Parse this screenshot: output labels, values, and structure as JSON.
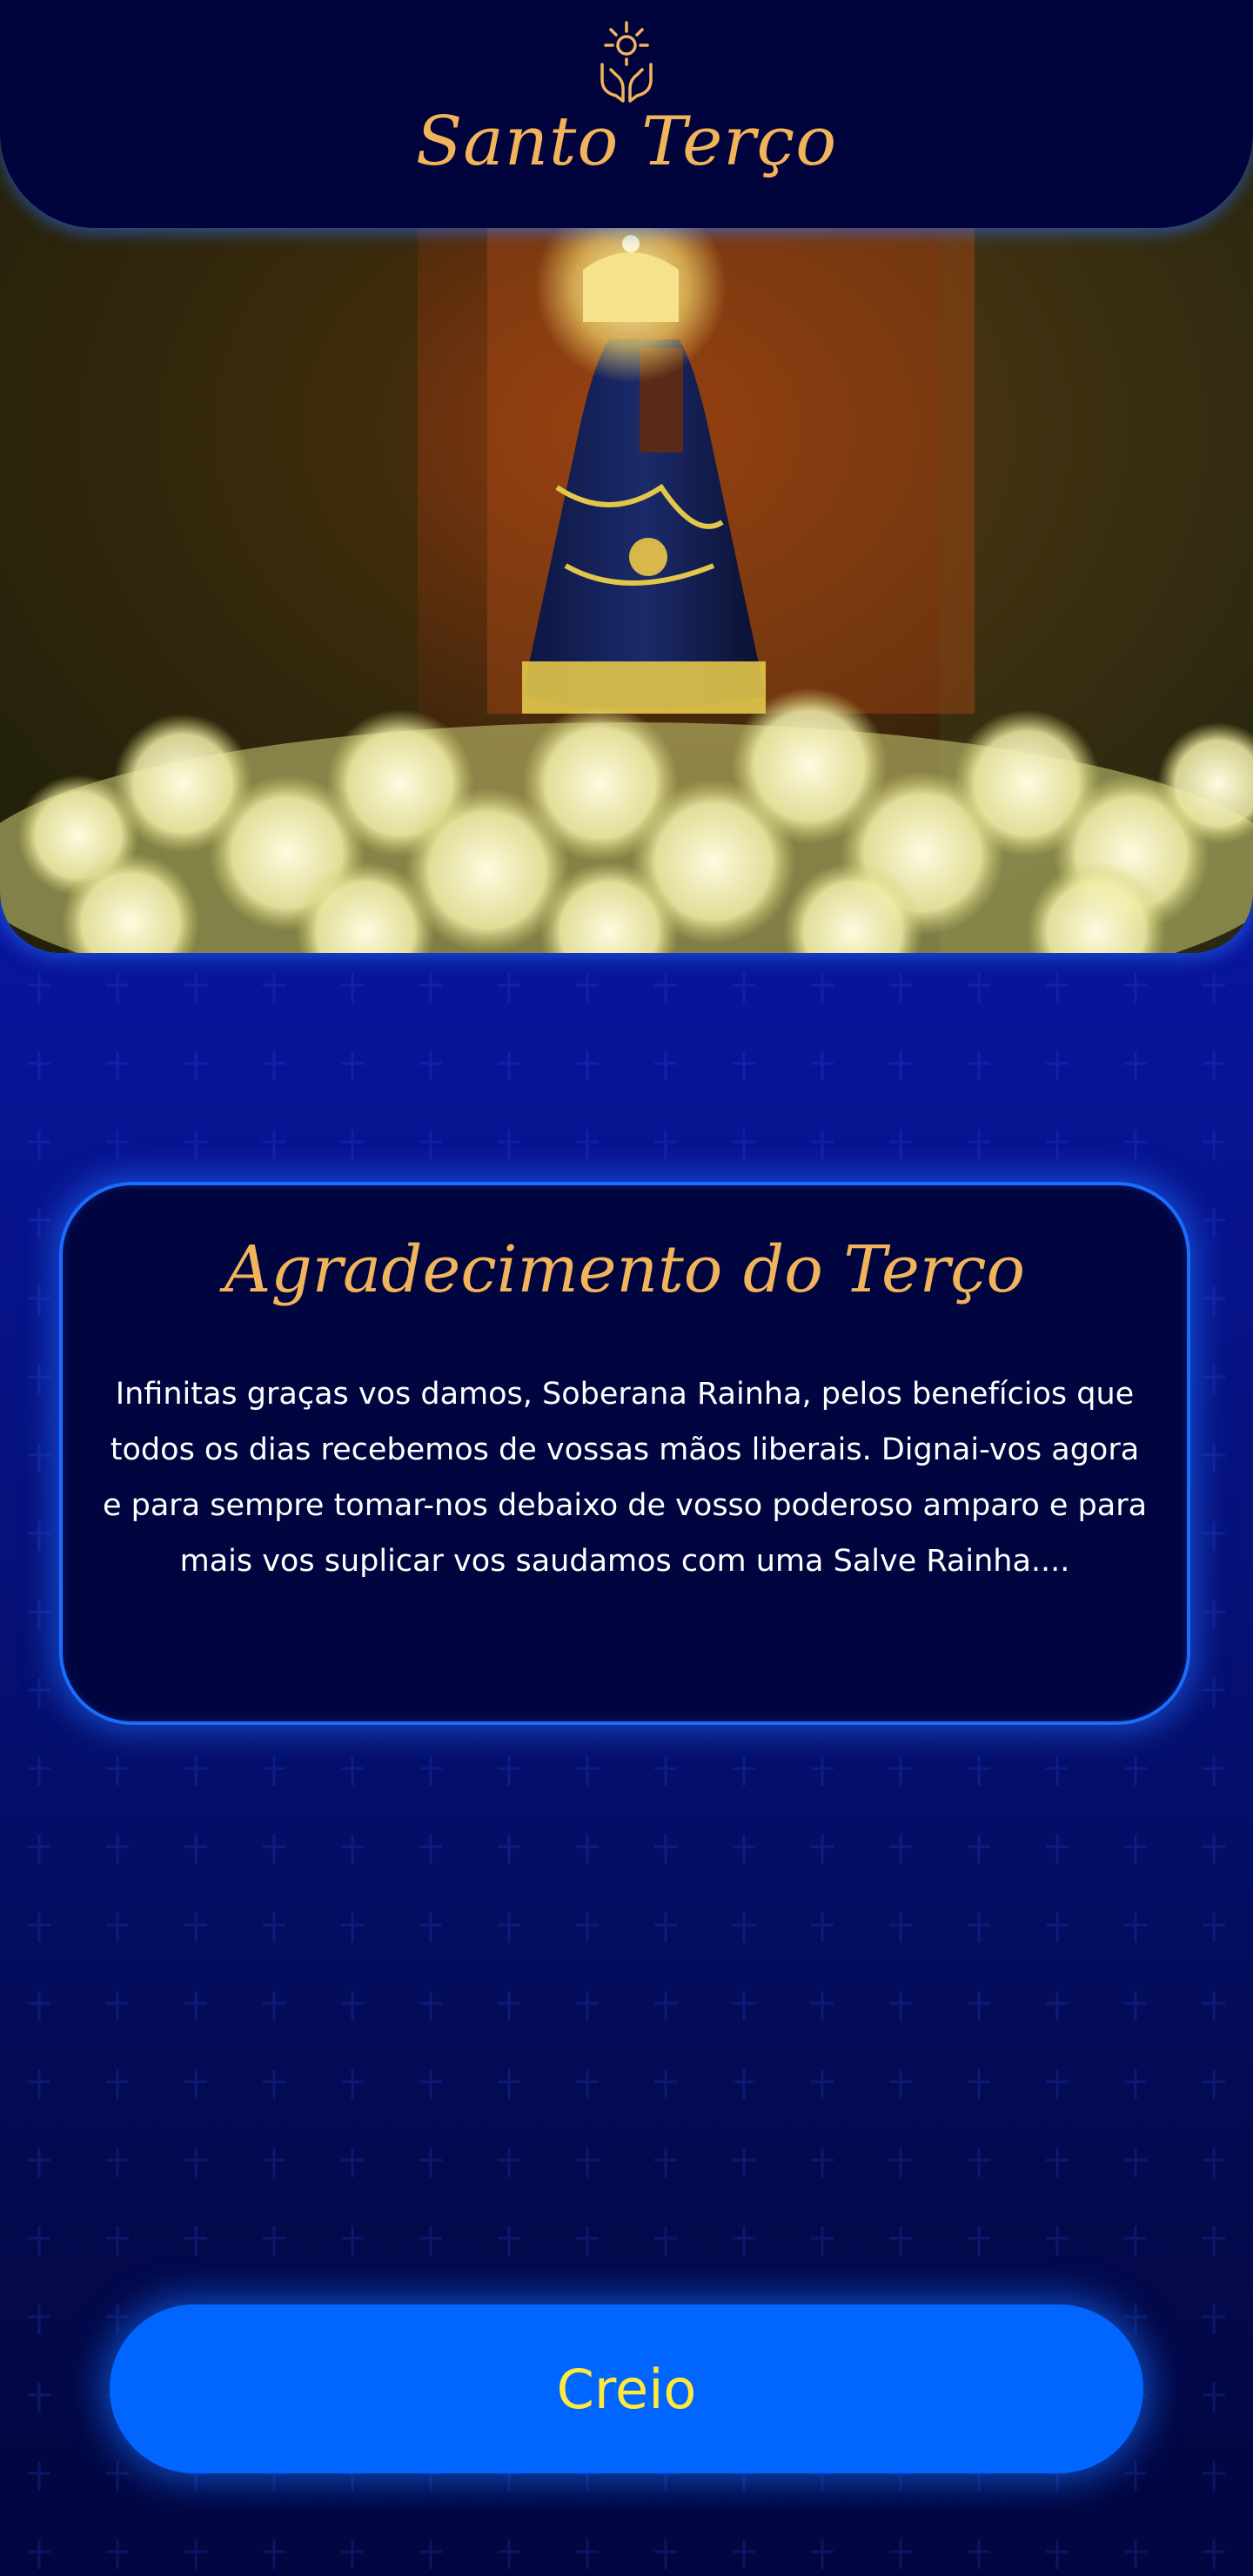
{
  "app": {
    "title": "Santo Terço",
    "logo_icon": "praying-hands-host-icon"
  },
  "hero": {
    "image": "our-lady-aparecida-statue-with-white-flowers"
  },
  "card": {
    "title": "Agradecimento do Terço",
    "body": "Infinitas graças vos damos, Soberana Rainha, pelos benefícios que todos os dias recebemos de vossas mãos liberais. Dignai-vos agora e para sempre tomar-nos debaixo de vosso poderoso amparo e para mais vos suplicar vos saudamos com uma Salve Rainha...."
  },
  "action": {
    "button_label": "Creio"
  },
  "colors": {
    "gold": "#f2b45a",
    "header": "#01033c",
    "card": "#000540",
    "accent_blue": "#0066ff",
    "button_text": "#ffe93a"
  }
}
